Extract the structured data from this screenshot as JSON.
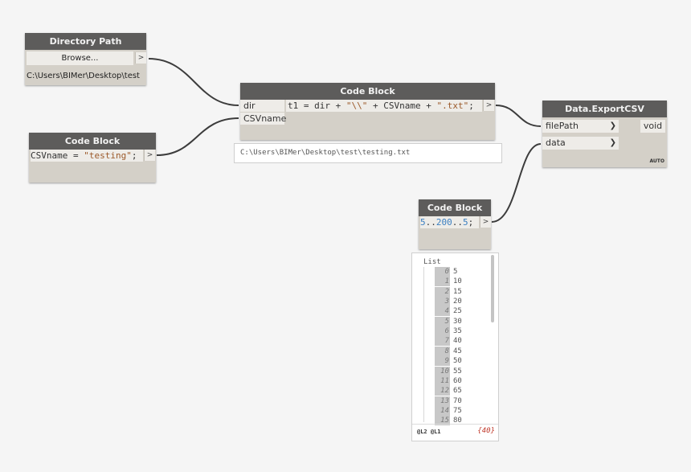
{
  "nodes": {
    "directory_path": {
      "title": "Directory Path",
      "browse_label": "Browse...",
      "output_arrow": ">",
      "path": "C:\\Users\\BIMer\\Desktop\\test"
    },
    "code_block_csvname": {
      "title": "Code Block",
      "code_pre": "CSVname = ",
      "code_str": "\"testing\"",
      "code_post": ";",
      "output_arrow": ">"
    },
    "code_block_concat": {
      "title": "Code Block",
      "inputs": [
        "dir",
        "CSVname"
      ],
      "code_pre": "t1 = dir + ",
      "code_str1": "\"\\\\\"",
      "code_mid": " + CSVname + ",
      "code_str2": "\".txt\"",
      "code_post": ";",
      "output_arrow": ">",
      "preview": "C:\\Users\\BIMer\\Desktop\\test\\testing.txt"
    },
    "export_csv": {
      "title": "Data.ExportCSV",
      "inputs": [
        "filePath",
        "data"
      ],
      "input_arrow": "❯",
      "output": "void",
      "lacing": "AUTO"
    },
    "code_block_range": {
      "title": "Code Block",
      "code_num1": "5",
      "code_dots1": "..",
      "code_num2": "200",
      "code_dots2": "..",
      "code_num3": "5",
      "code_post": ";",
      "output_arrow": ">"
    }
  },
  "watch": {
    "title": "List",
    "items": [
      {
        "index": "0",
        "value": "5"
      },
      {
        "index": "1",
        "value": "10"
      },
      {
        "index": "2",
        "value": "15"
      },
      {
        "index": "3",
        "value": "20"
      },
      {
        "index": "4",
        "value": "25"
      },
      {
        "index": "5",
        "value": "30"
      },
      {
        "index": "6",
        "value": "35"
      },
      {
        "index": "7",
        "value": "40"
      },
      {
        "index": "8",
        "value": "45"
      },
      {
        "index": "9",
        "value": "50"
      },
      {
        "index": "10",
        "value": "55"
      },
      {
        "index": "11",
        "value": "60"
      },
      {
        "index": "12",
        "value": "65"
      },
      {
        "index": "13",
        "value": "70"
      },
      {
        "index": "14",
        "value": "75"
      },
      {
        "index": "15",
        "value": "80"
      }
    ],
    "levels": "@L2 @L1",
    "count": "{40}"
  },
  "colors": {
    "canvas": "#f5f5f5",
    "node_header": "#5d5c5b",
    "node_body": "#d4d0c8",
    "wire": "#3c3c3c",
    "string_token": "#9c5a2a",
    "number_token": "#3a7fc1",
    "count_text": "#c0392b"
  }
}
